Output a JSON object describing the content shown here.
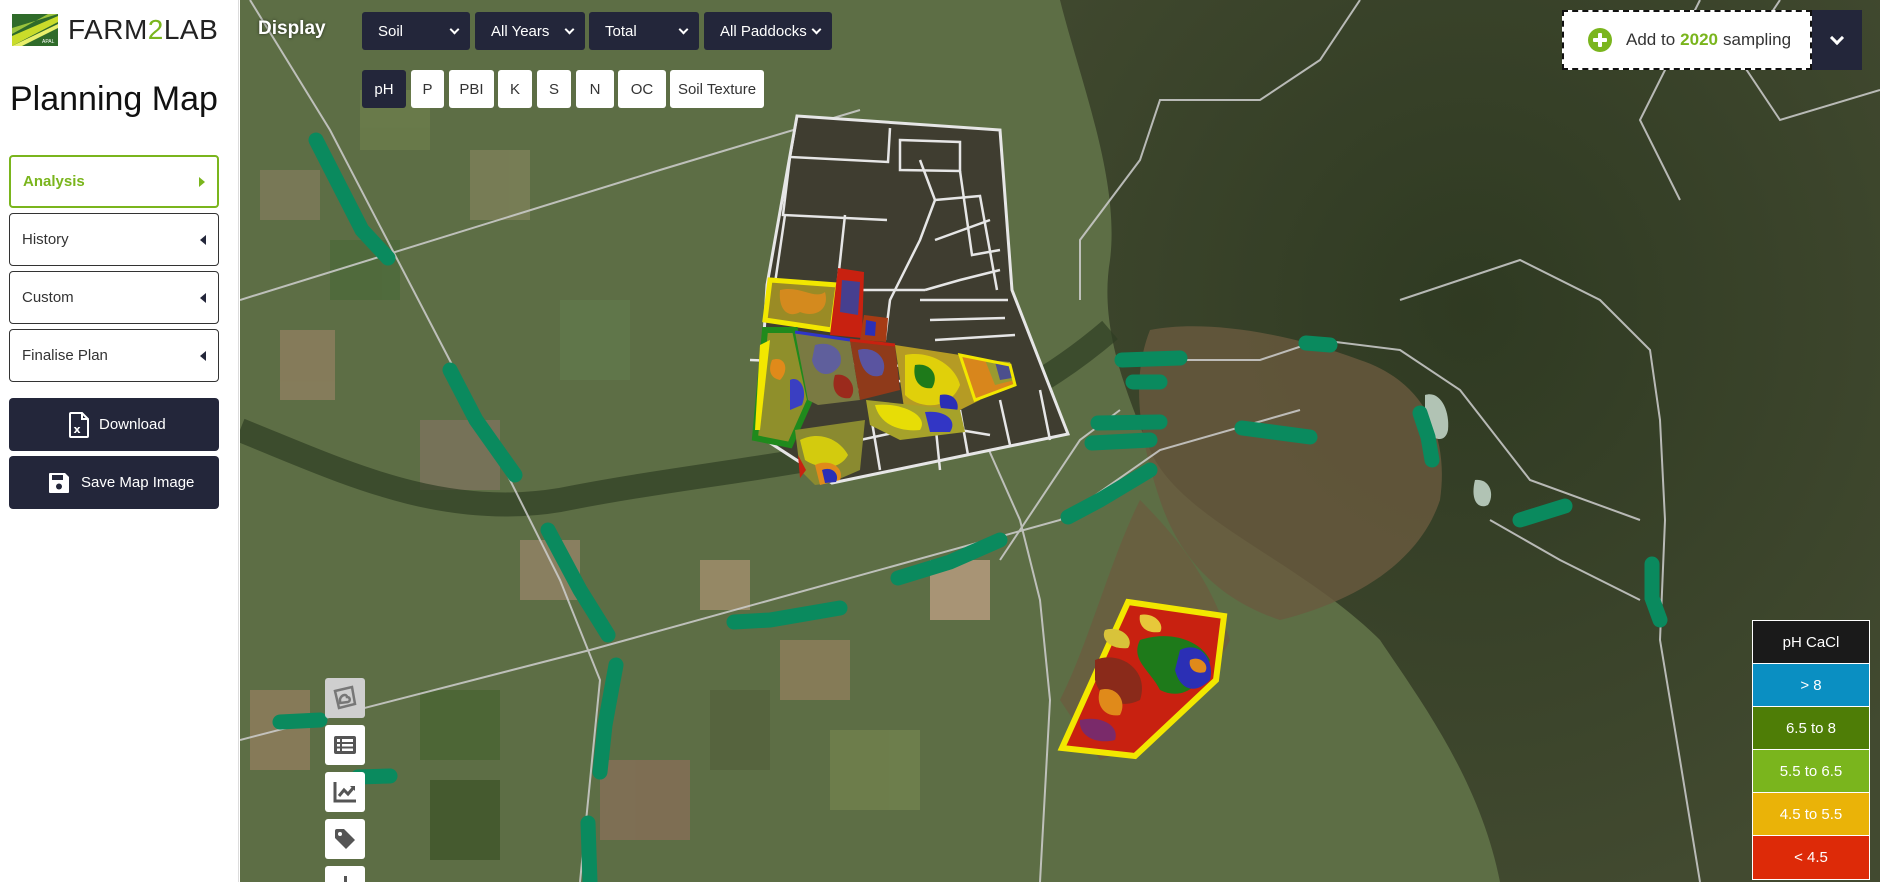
{
  "brand": {
    "name_left": "FARM",
    "name_mid": "2",
    "name_right": "LAB",
    "badge": "APAL"
  },
  "page_title": "Planning Map",
  "nav": [
    {
      "label": "Analysis",
      "active": true
    },
    {
      "label": "History",
      "active": false
    },
    {
      "label": "Custom",
      "active": false
    },
    {
      "label": "Finalise Plan",
      "active": false
    }
  ],
  "actions": {
    "download": "Download",
    "save_image": "Save Map Image"
  },
  "display": {
    "label": "Display",
    "selects": [
      {
        "value": "Soil"
      },
      {
        "value": "All Years"
      },
      {
        "value": "Total"
      },
      {
        "value": "All Paddocks"
      }
    ],
    "analytes": [
      {
        "label": "pH",
        "active": true
      },
      {
        "label": "P",
        "active": false
      },
      {
        "label": "PBI",
        "active": false
      },
      {
        "label": "K",
        "active": false
      },
      {
        "label": "S",
        "active": false
      },
      {
        "label": "N",
        "active": false
      },
      {
        "label": "OC",
        "active": false
      },
      {
        "label": "Soil Texture",
        "active": false
      }
    ]
  },
  "sampling": {
    "prefix": "Add to",
    "year": "2020",
    "suffix": "sampling"
  },
  "tools": [
    "draw-paddock-icon",
    "list-icon",
    "chart-icon",
    "tag-icon"
  ],
  "legend": {
    "title": "pH CaCl",
    "title_color": "#1a1a1a",
    "items": [
      {
        "label": "> 8",
        "color": "#0a8fc2"
      },
      {
        "label": "6.5 to 8",
        "color": "#4e7d06"
      },
      {
        "label": "5.5 to 6.5",
        "color": "#7ab51d"
      },
      {
        "label": "4.5 to 5.5",
        "color": "#eab308"
      },
      {
        "label": "< 4.5",
        "color": "#dd2a08"
      }
    ]
  },
  "colors": {
    "accent": "#7ab51d",
    "dark": "#23263a",
    "route": "#0a8a5e",
    "paddock_outline": "#e6e6e6"
  }
}
